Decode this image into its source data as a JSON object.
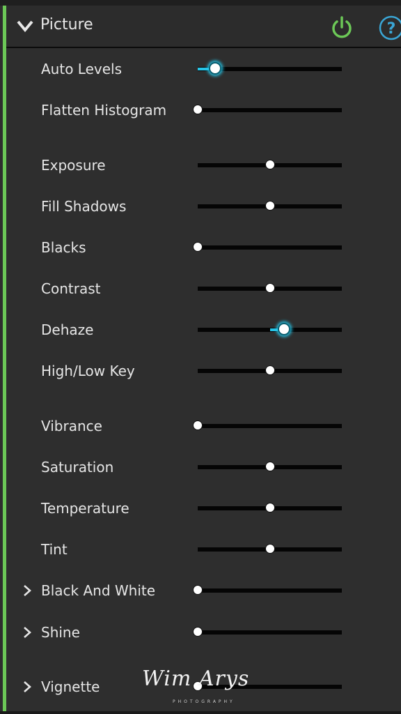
{
  "panel": {
    "title": "Picture",
    "expanded": true,
    "power_state": "on",
    "colors": {
      "accent": "#6cc857",
      "power": "#6cc857",
      "help": "#3aa6d6",
      "slider_active": "#28c4e6"
    }
  },
  "sliders": [
    {
      "label": "Auto Levels",
      "value": 0.12,
      "origin": 0.0,
      "active": true,
      "expandable": false
    },
    {
      "label": "Flatten Histogram",
      "value": 0.0,
      "origin": 0.0,
      "active": false,
      "expandable": false
    },
    {
      "label": "Exposure",
      "value": 0.5,
      "origin": 0.5,
      "active": false,
      "expandable": false
    },
    {
      "label": "Fill Shadows",
      "value": 0.5,
      "origin": 0.5,
      "active": false,
      "expandable": false
    },
    {
      "label": "Blacks",
      "value": 0.0,
      "origin": 0.0,
      "active": false,
      "expandable": false
    },
    {
      "label": "Contrast",
      "value": 0.5,
      "origin": 0.5,
      "active": false,
      "expandable": false
    },
    {
      "label": "Dehaze",
      "value": 0.6,
      "origin": 0.5,
      "active": true,
      "expandable": false
    },
    {
      "label": "High/Low Key",
      "value": 0.5,
      "origin": 0.5,
      "active": false,
      "expandable": false
    },
    {
      "label": "Vibrance",
      "value": 0.0,
      "origin": 0.0,
      "active": false,
      "expandable": false
    },
    {
      "label": "Saturation",
      "value": 0.5,
      "origin": 0.5,
      "active": false,
      "expandable": false
    },
    {
      "label": "Temperature",
      "value": 0.5,
      "origin": 0.5,
      "active": false,
      "expandable": false
    },
    {
      "label": "Tint",
      "value": 0.5,
      "origin": 0.5,
      "active": false,
      "expandable": false
    },
    {
      "label": "Black And White",
      "value": 0.0,
      "origin": 0.0,
      "active": false,
      "expandable": true
    },
    {
      "label": "Shine",
      "value": 0.0,
      "origin": 0.0,
      "active": false,
      "expandable": true
    },
    {
      "label": "Vignette",
      "value": 0.0,
      "origin": 0.0,
      "active": false,
      "expandable": true
    }
  ],
  "watermark": {
    "signature": "Wim Arys",
    "subtitle": "PHOTOGRAPHY"
  }
}
